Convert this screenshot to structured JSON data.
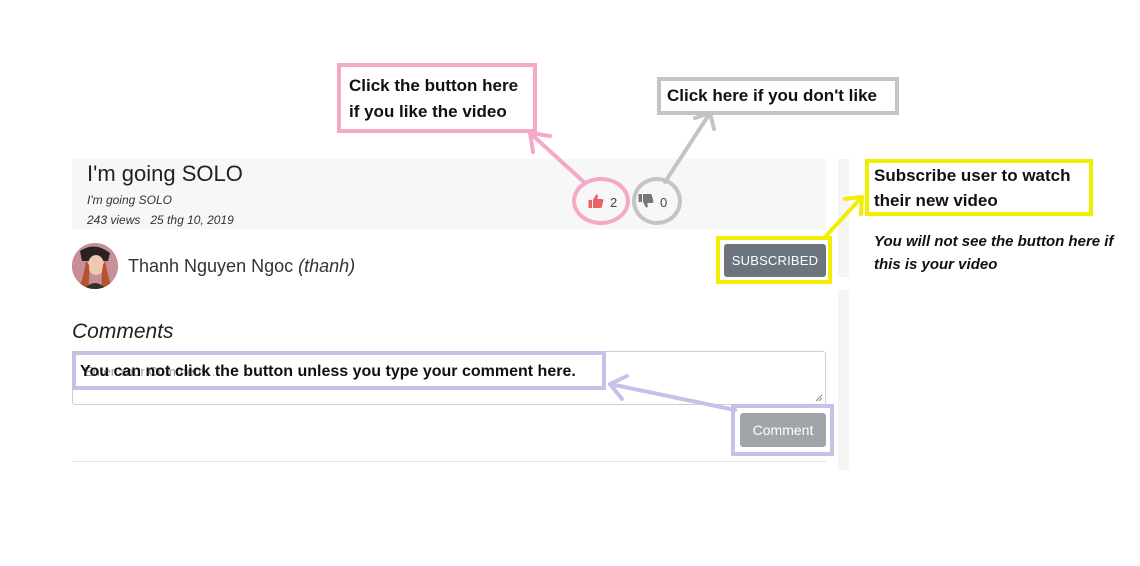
{
  "video": {
    "title": "I'm going SOLO",
    "subtitle": "I'm going SOLO",
    "views": "243 views",
    "date": "25 thg 10, 2019",
    "like_count": "2",
    "dislike_count": "0"
  },
  "channel": {
    "name": "Thanh Nguyen Ngoc",
    "handle": "(thanh)",
    "subscribe_label": "SUBSCRIBED"
  },
  "comments": {
    "heading": "Comments",
    "placeholder": "Enter Your Comment...",
    "submit_label": "Comment"
  },
  "annotations": {
    "like": "Click the button here if you like the video",
    "dislike": "Click here if you don't like",
    "subscribe": "Subscribe user to watch their new video",
    "subscribe_note": "You will not see the button here if  this is your video",
    "comment": "You can not click the button unless you type your comment here."
  },
  "colors": {
    "like_annotation": "#f4a9c8",
    "dislike_annotation": "#c4c4c4",
    "subscribe_annotation": "#f2ee00",
    "comment_annotation": "#c6c1e6",
    "like_icon": "#e8616b",
    "dislike_icon": "#777777",
    "subscribe_button": "#6c757d",
    "comment_button": "#a1a5aa"
  },
  "icons": {
    "like": "thumbs-up-icon",
    "dislike": "thumbs-down-icon",
    "avatar": "user-avatar"
  }
}
